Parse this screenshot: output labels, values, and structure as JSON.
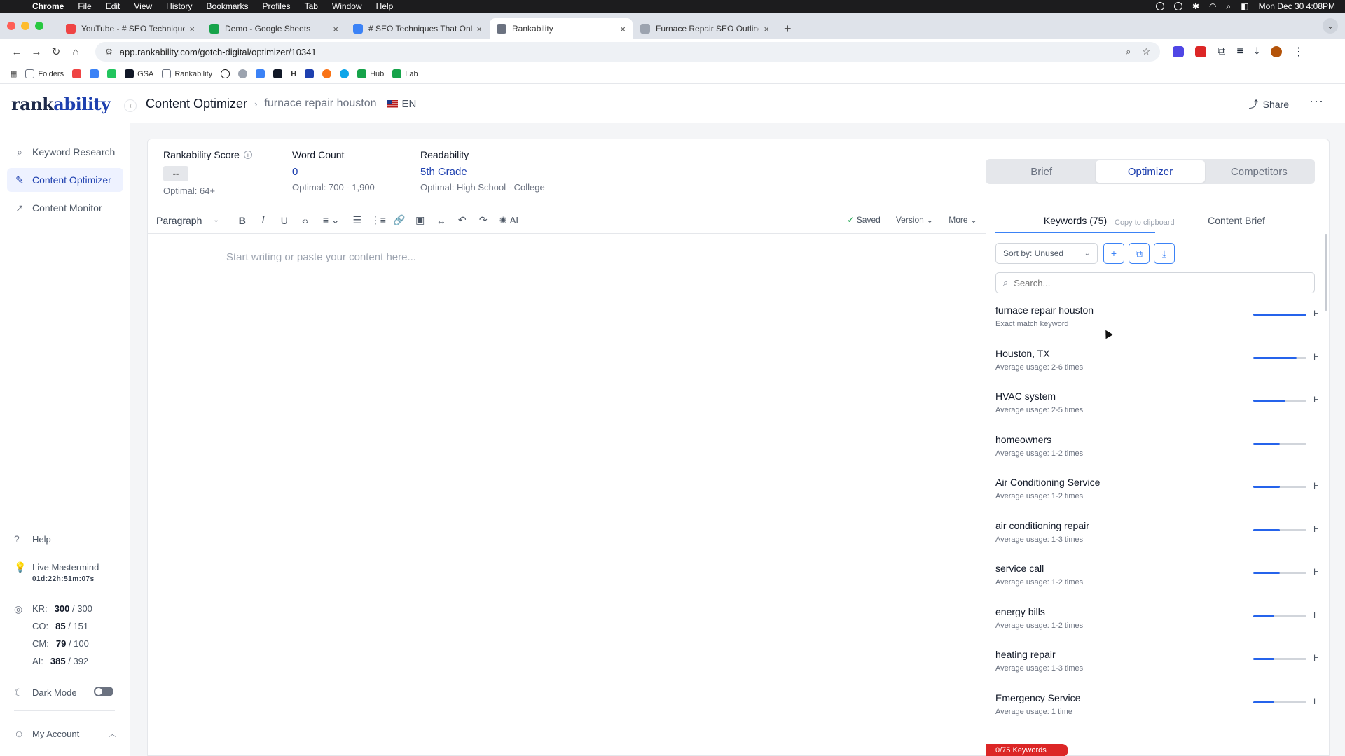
{
  "menubar": {
    "app": "Chrome",
    "items": [
      "File",
      "Edit",
      "View",
      "History",
      "Bookmarks",
      "Profiles",
      "Tab",
      "Window",
      "Help"
    ],
    "datetime": "Mon Dec 30  4:08PM"
  },
  "tabs": [
    {
      "title": "YouTube - # SEO Techniques",
      "color": "#ef4444",
      "active": false
    },
    {
      "title": "Demo - Google Sheets",
      "color": "#16a34a",
      "active": false
    },
    {
      "title": "# SEO Techniques That Only",
      "color": "#3b82f6",
      "active": false
    },
    {
      "title": "Rankability",
      "color": "#6b7280",
      "active": true
    },
    {
      "title": "Furnace Repair SEO Outline",
      "color": "#9ca3af",
      "active": false
    }
  ],
  "address": {
    "url": "app.rankability.com/gotch-digital/optimizer/10341"
  },
  "bookmarks": [
    {
      "label": "Folders",
      "color": "#6b7280"
    },
    {
      "label": "",
      "color": "#ef4444"
    },
    {
      "label": "",
      "color": "#3b82f6"
    },
    {
      "label": "",
      "color": "#22c55e"
    },
    {
      "label": "GSA",
      "color": "#111827"
    },
    {
      "label": "Rankability",
      "color": "#6b7280"
    },
    {
      "label": "",
      "color": "#111827"
    },
    {
      "label": "",
      "color": "#6b7280"
    },
    {
      "label": "",
      "color": "#3b82f6"
    },
    {
      "label": "",
      "color": "#111827"
    },
    {
      "label": "H",
      "color": "#ffffff"
    },
    {
      "label": "",
      "color": "#1e40af"
    },
    {
      "label": "",
      "color": "#f97316"
    },
    {
      "label": "",
      "color": "#0ea5e9"
    },
    {
      "label": "Hub",
      "color": "#16a34a"
    },
    {
      "label": "Lab",
      "color": "#16a34a"
    }
  ],
  "brand": {
    "logo_main": "rank",
    "logo_accent": "ability"
  },
  "sidebar": {
    "nav": [
      {
        "label": "Keyword Research",
        "icon": "search-icon"
      },
      {
        "label": "Content Optimizer",
        "icon": "magic-wand-icon"
      },
      {
        "label": "Content Monitor",
        "icon": "chart-line-icon"
      }
    ],
    "help": "Help",
    "mastermind": "Live Mastermind",
    "timer": "01d:22h:51m:07s",
    "credits": [
      {
        "label": "KR:",
        "used": "300",
        "total": "/ 300"
      },
      {
        "label": "CO:",
        "used": "85",
        "total": "/ 151"
      },
      {
        "label": "CM:",
        "used": "79",
        "total": "/ 100"
      },
      {
        "label": "AI:",
        "used": "385",
        "total": "/ 392"
      }
    ],
    "dark_mode": "Dark Mode",
    "account": "My Account"
  },
  "header": {
    "title": "Content Optimizer",
    "keyword": "furnace repair houston",
    "lang": "EN",
    "share": "Share"
  },
  "metrics": {
    "score": {
      "label": "Rankability Score",
      "value": "--",
      "optimal": "Optimal: 64+"
    },
    "words": {
      "label": "Word Count",
      "value": "0",
      "optimal": "Optimal: 700 - 1,900"
    },
    "readability": {
      "label": "Readability",
      "value": "5th Grade",
      "optimal": "Optimal: High School - College"
    }
  },
  "view_tabs": [
    "Brief",
    "Optimizer",
    "Competitors"
  ],
  "toolbar": {
    "paragraph": "Paragraph",
    "ai": "AI",
    "saved": "Saved",
    "version": "Version",
    "more": "More"
  },
  "editor": {
    "placeholder": "Start writing or paste your content here..."
  },
  "panel": {
    "tab_keywords": "Keywords (75)",
    "tab_brief": "Content Brief",
    "tooltip": "Copy to clipboard",
    "sort": "Sort by: Unused",
    "search_placeholder": "Search...",
    "keyword_count": "0/75 Keywords"
  },
  "keywords": [
    {
      "name": "furnace repair houston",
      "sub": "Exact match keyword",
      "fill": 100,
      "level": "H"
    },
    {
      "name": "Houston, TX",
      "sub": "Average usage: 2-6 times",
      "fill": 82,
      "level": "H"
    },
    {
      "name": "HVAC system",
      "sub": "Average usage: 2-5 times",
      "fill": 60,
      "level": "H"
    },
    {
      "name": "homeowners",
      "sub": "Average usage: 1-2 times",
      "fill": 50,
      "level": ""
    },
    {
      "name": "Air Conditioning Service",
      "sub": "Average usage: 1-2 times",
      "fill": 50,
      "level": "H"
    },
    {
      "name": "air conditioning repair",
      "sub": "Average usage: 1-3 times",
      "fill": 50,
      "level": "H"
    },
    {
      "name": "service call",
      "sub": "Average usage: 1-2 times",
      "fill": 50,
      "level": "H"
    },
    {
      "name": "energy bills",
      "sub": "Average usage: 1-2 times",
      "fill": 40,
      "level": "H"
    },
    {
      "name": "heating repair",
      "sub": "Average usage: 1-3 times",
      "fill": 40,
      "level": "H"
    },
    {
      "name": "Emergency Service",
      "sub": "Average usage: 1 time",
      "fill": 40,
      "level": "H"
    }
  ]
}
